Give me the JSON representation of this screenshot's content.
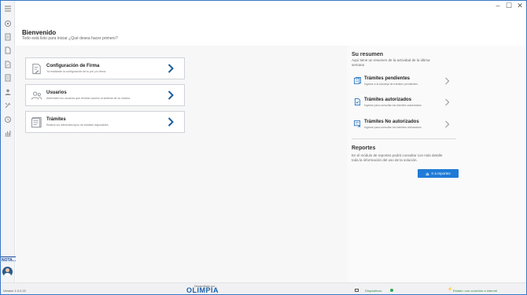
{
  "window": {
    "minimize_glyph": "–",
    "maximize_glyph": "☐",
    "close_glyph": "✕"
  },
  "sidebar": {
    "items": [
      {
        "icon": "menu-icon"
      },
      {
        "icon": "circle-settings-icon"
      },
      {
        "icon": "documents-icon"
      },
      {
        "icon": "document-icon"
      },
      {
        "icon": "file-sign-icon"
      },
      {
        "icon": "file-list-icon"
      },
      {
        "icon": "user-icon"
      },
      {
        "icon": "tools-icon"
      },
      {
        "icon": "clock-icon"
      },
      {
        "icon": "chart-icon"
      }
    ],
    "user_label": "NOTA...",
    "avatar_icon": "user-avatar"
  },
  "header": {
    "title": "Bienvenido",
    "subtitle": "Todo está listo para iniciar ¿Qué desea hacer primero?"
  },
  "cards": [
    {
      "title": "Configuración de Firma",
      "description": "Ya realizaste la configuración de tu pin y tu firma.",
      "icon": "signature-document-icon"
    },
    {
      "title": "Usuarios",
      "description": "Administre los usuarios que tendrán acceso al sistema de su notaría",
      "icon": "users-icon"
    },
    {
      "title": "Trámites",
      "description": "Realice los diferentes tipos de trámites disponibles",
      "icon": "procedures-icon"
    }
  ],
  "summary": {
    "title": "Su resumen",
    "description": "Aquí tiene un resumen de la actividad de la última semana",
    "items": [
      {
        "title": "Trámites pendientes",
        "description": "Ingrese a la bandeja de trámites pendientes",
        "icon": "pending-icon"
      },
      {
        "title": "Trámites autorizados",
        "description": "Ingrese para consultar los trámites autorizados",
        "icon": "authorized-icon"
      },
      {
        "title": "Trámites No autorizados",
        "description": "Ingrese para consultar los trámites rechazados",
        "icon": "rejected-icon"
      }
    ]
  },
  "reports": {
    "title": "Reportes",
    "description": "En el módulo de reportes podrá consultar con más detalle toda la información del uso de la solución.",
    "button_label": "Ir a reportes"
  },
  "footer": {
    "version": "Version 1.0.0.22",
    "developed_by": "Desarrollado por",
    "logo_text": "OLIMPIA",
    "devices_label": "Dispositivos",
    "connection_label": "Estado: con conexión a internet"
  },
  "colors": {
    "accent": "#1f7bd6",
    "status_ok": "#2fa84f",
    "chevron": "#1f5f9e"
  }
}
